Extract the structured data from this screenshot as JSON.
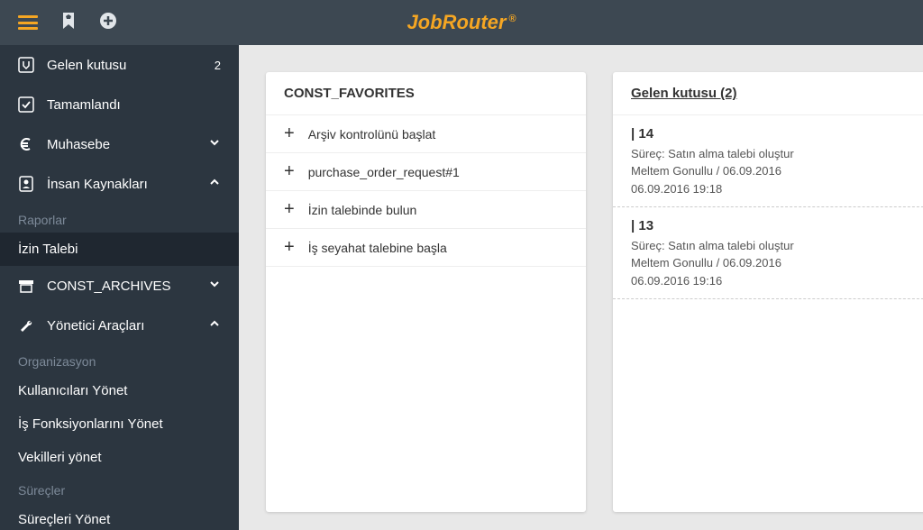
{
  "logo": {
    "main": "JobRouter",
    "reg": "®"
  },
  "sidebar": {
    "items": [
      {
        "label": "Gelen kutusu",
        "badge": "2"
      },
      {
        "label": "Tamamlandı"
      },
      {
        "label": "Muhasebe"
      },
      {
        "label": "İnsan Kaynakları"
      }
    ],
    "hr_section_label": "Raporlar",
    "hr_subitems": [
      {
        "label": "İzin Talebi"
      }
    ],
    "archives_label": "CONST_ARCHIVES",
    "admin_label": "Yönetici Araçları",
    "org_section_label": "Organizasyon",
    "org_subitems": [
      {
        "label": "Kullanıcıları Yönet"
      },
      {
        "label": "İş Fonksiyonlarını Yönet"
      },
      {
        "label": "Vekilleri yönet"
      }
    ],
    "proc_section_label": "Süreçler",
    "proc_subitems": [
      {
        "label": "Süreçleri Yönet"
      }
    ]
  },
  "favorites": {
    "title": "CONST_FAVORITES",
    "items": [
      {
        "label": "Arşiv kontrolünü başlat"
      },
      {
        "label": "purchase_order_request#1"
      },
      {
        "label": "İzin talebinde bulun"
      },
      {
        "label": "İş seyahat talebine başla"
      }
    ]
  },
  "inbox": {
    "title": "Gelen kutusu (2)",
    "items": [
      {
        "num": "| 14",
        "process": "Süreç: Satın alma talebi oluştur",
        "meta": "Meltem Gonullu / 06.09.2016",
        "time": "06.09.2016 19:18"
      },
      {
        "num": "| 13",
        "process": "Süreç: Satın alma talebi oluştur",
        "meta": "Meltem Gonullu / 06.09.2016",
        "time": "06.09.2016 19:16"
      }
    ]
  }
}
